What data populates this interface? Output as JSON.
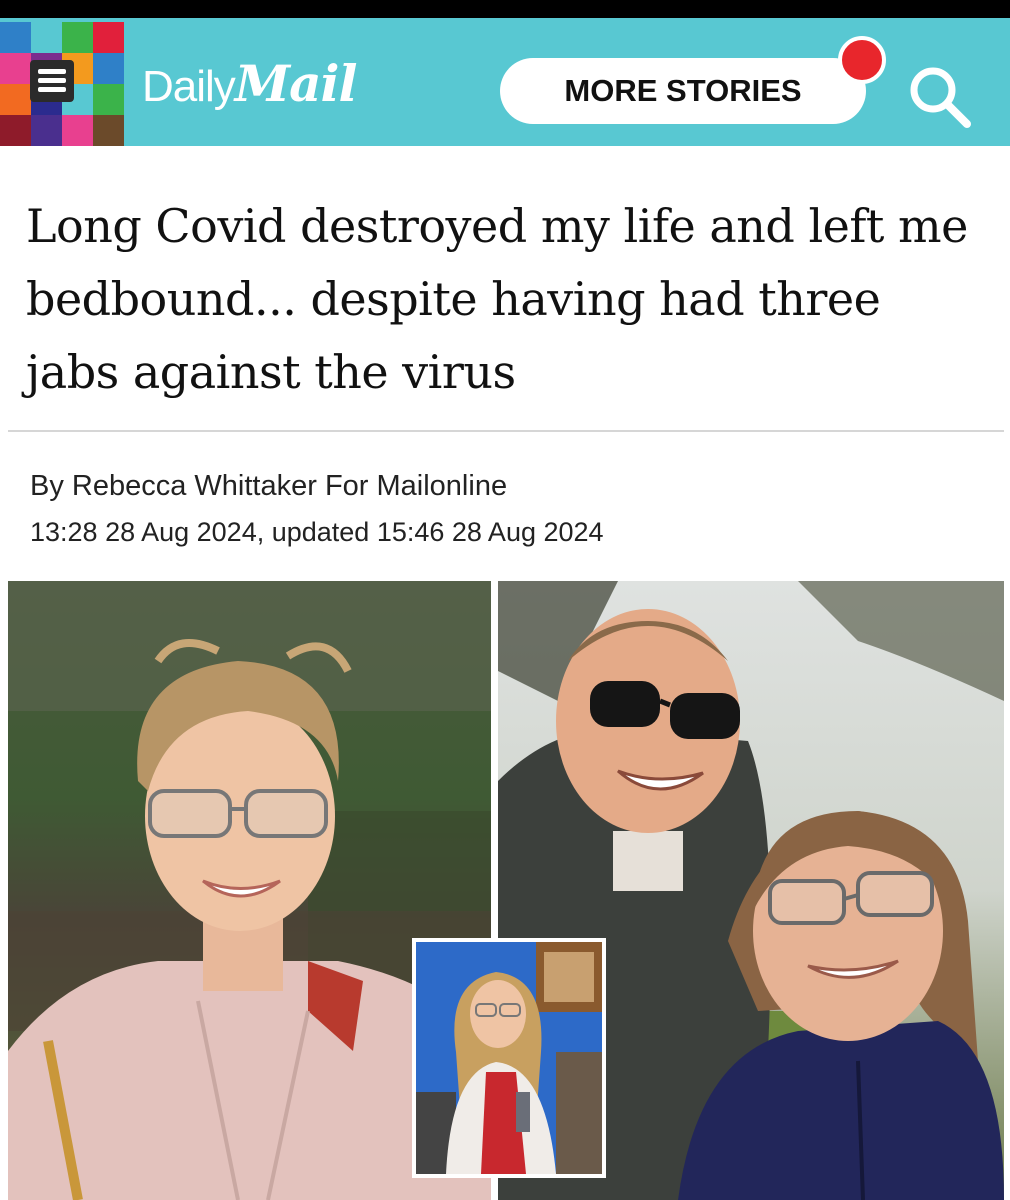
{
  "header": {
    "brand_daily": "Daily",
    "brand_mail": "Mail",
    "more_stories_label": "MORE STORIES",
    "accent_color": "#58c8d2",
    "notification_color": "#e8262c",
    "menu_icon": "hamburger-menu-icon",
    "search_icon": "search-icon"
  },
  "article": {
    "headline": "Long Covid destroyed my life and left me bedbound... despite having had three jabs against the virus",
    "byline": "By Rebecca Whittaker For Mailonline",
    "timestamp": "13:28 28 Aug 2024, updated 15:46 28 Aug 2024"
  },
  "images": {
    "left_photo": "woman-outdoors-photo",
    "right_photo": "couple-selfie-photo",
    "inset_photo": "woman-in-kitchen-photo"
  }
}
